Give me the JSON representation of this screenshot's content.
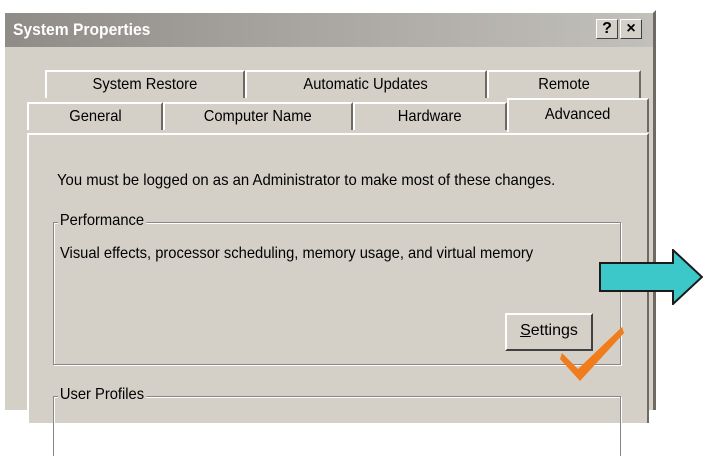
{
  "window": {
    "title": "System Properties",
    "help_button": "?",
    "close_button": "×"
  },
  "tabs": {
    "back_row": [
      {
        "label": "System Restore"
      },
      {
        "label": "Automatic Updates"
      },
      {
        "label": "Remote"
      }
    ],
    "front_row": [
      {
        "label": "General"
      },
      {
        "label": "Computer Name"
      },
      {
        "label": "Hardware"
      },
      {
        "label": "Advanced"
      }
    ],
    "active": "Advanced"
  },
  "advanced": {
    "admin_note": "You must be logged on as an Administrator to make most of these changes.",
    "performance": {
      "label": "Performance",
      "description": "Visual effects, processor scheduling, memory usage, and virtual memory",
      "settings_button": {
        "prefix": "",
        "accel": "S",
        "rest": "ettings"
      }
    },
    "user_profiles": {
      "label": "User Profiles"
    }
  },
  "annotations": {
    "arrow_icon": "right-arrow-icon",
    "arrow_color": "#3cc8c8",
    "check_icon": "checkmark-icon",
    "check_color": "#f07c1c"
  }
}
